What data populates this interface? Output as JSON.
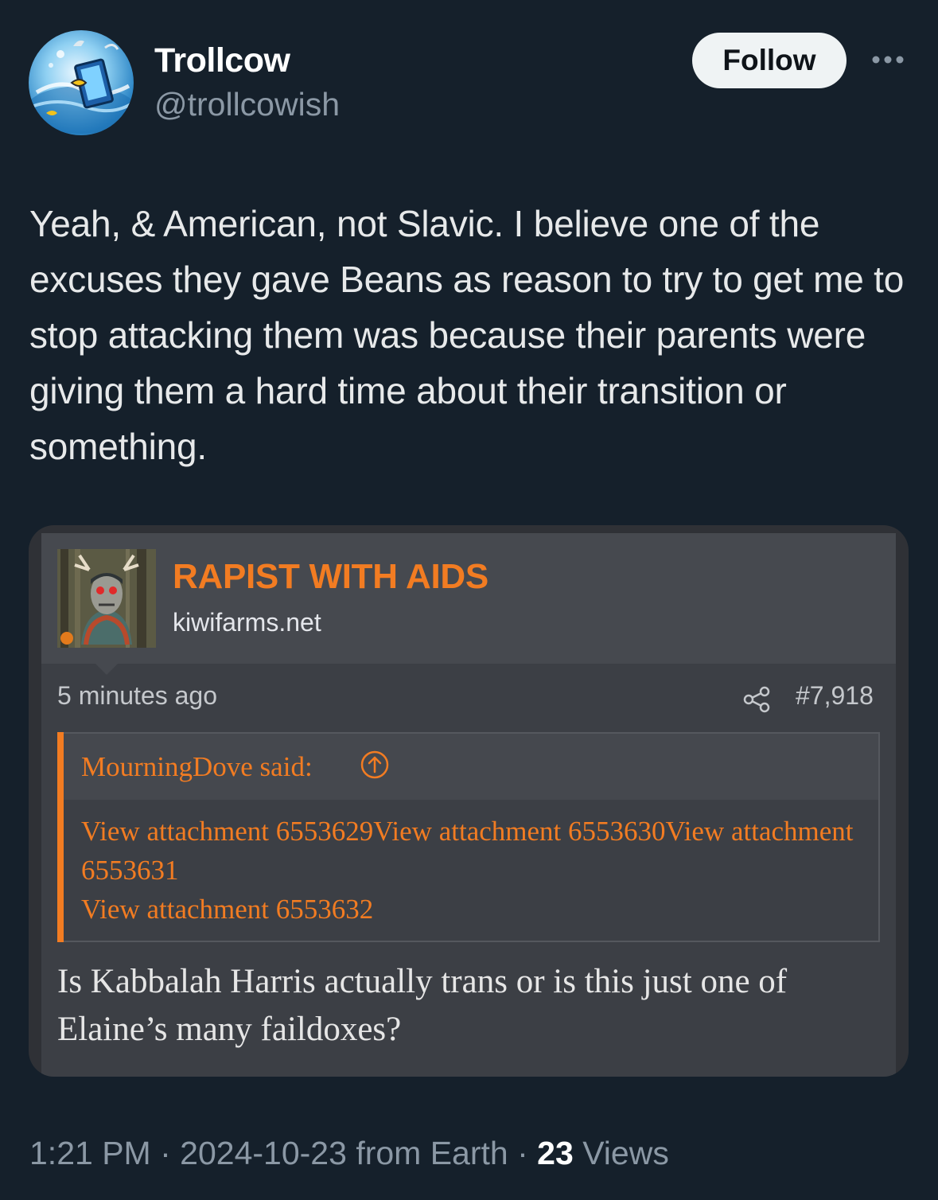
{
  "author": {
    "display_name": "Trollcow",
    "handle": "@trollcowish",
    "follow_label": "Follow"
  },
  "tweet": {
    "text": "Yeah, & American, not Slavic. I believe one of the excuses they gave Beans as reason to try to get me to stop attacking them was because their parents were giving them a hard time about their transition or something."
  },
  "attachment": {
    "poster_name": "RAPIST WITH AIDS",
    "site": "kiwifarms.net",
    "posted_ago": "5 minutes ago",
    "post_number": "#7,918",
    "quote": {
      "author_line": "MourningDove said:",
      "links": [
        "View attachment 6553629",
        "View attachment 6553630",
        "View attachment 6553631",
        "View attachment 6553632"
      ]
    },
    "message": "Is Kabbalah Harris actually trans or is this just one of Elaine’s many faildoxes?"
  },
  "meta": {
    "time": "1:21 PM",
    "separator": "·",
    "date": "2024-10-23",
    "source": "from Earth",
    "views_count": "23",
    "views_label": "Views"
  },
  "colors": {
    "background": "#15202b",
    "accent_orange": "#f27c22",
    "secondary_text": "#8b98a5"
  },
  "icons": {
    "more": "more-icon",
    "share": "share-icon",
    "quote_jump": "arrow-up-circle-icon"
  }
}
